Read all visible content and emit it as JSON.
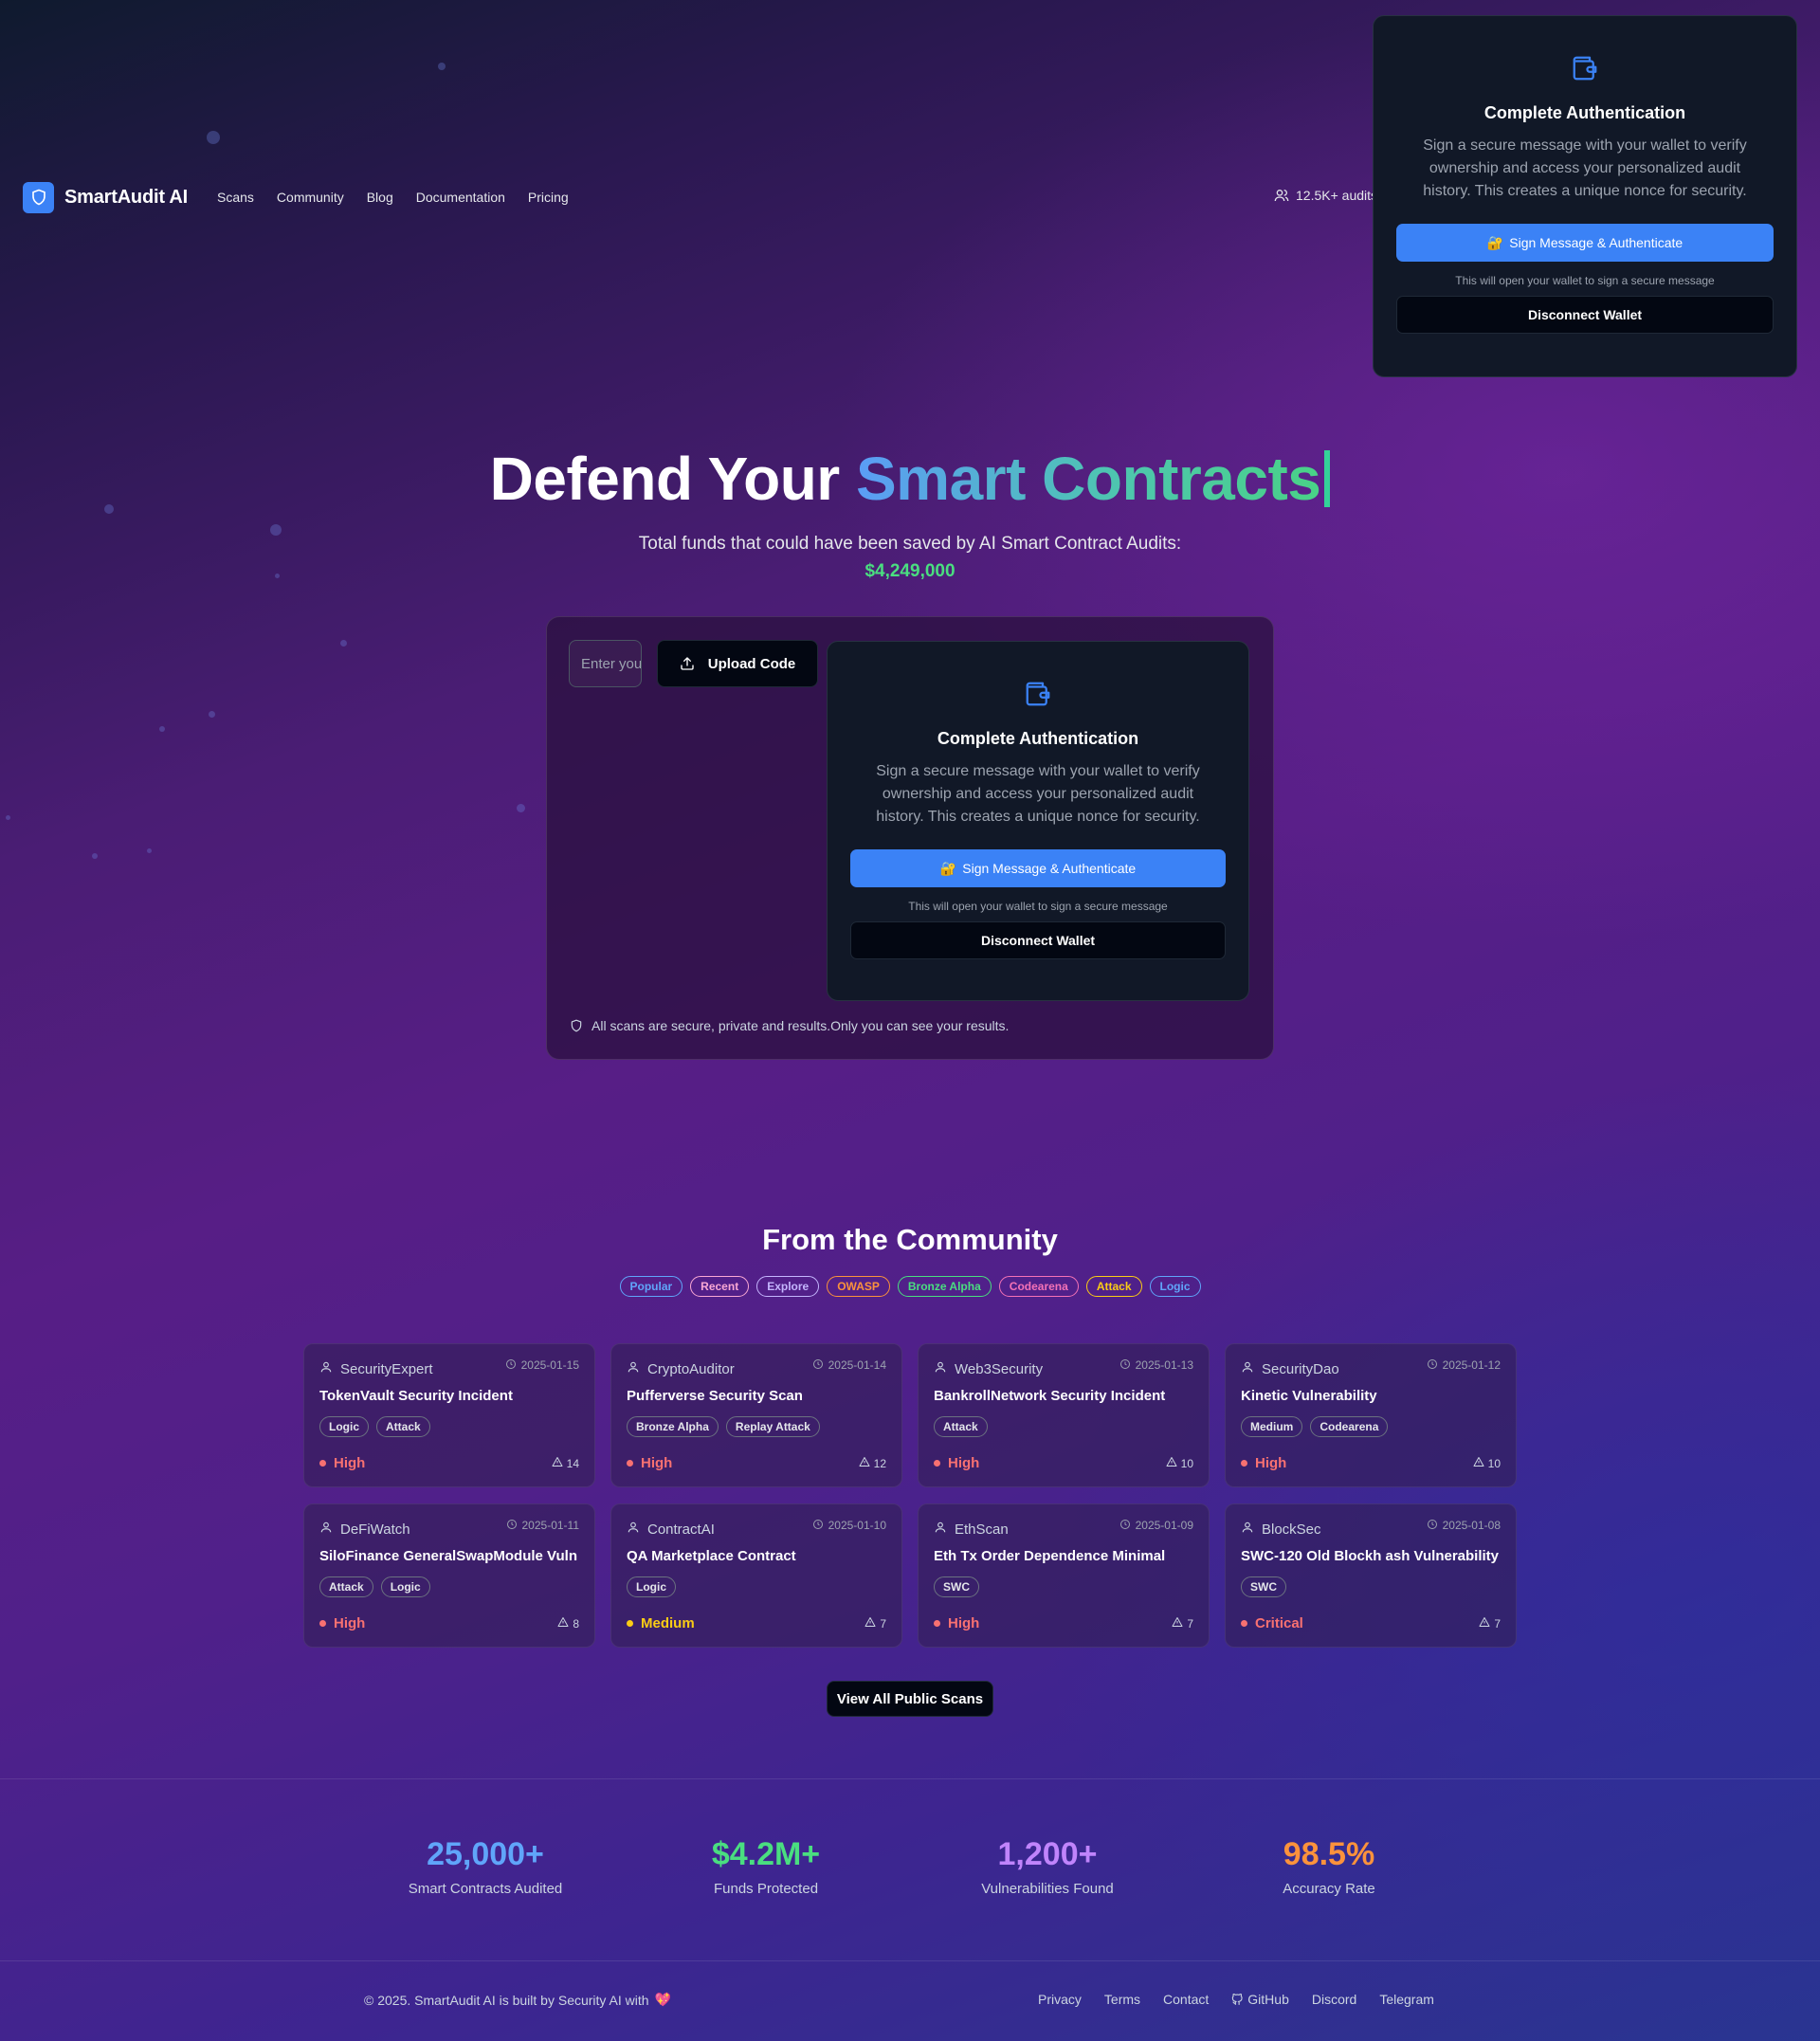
{
  "brand": {
    "name": "SmartAudit AI"
  },
  "nav": {
    "links": [
      "Scans",
      "Community",
      "Blog",
      "Documentation",
      "Pricing"
    ],
    "audits_count": "12.5K+ audits"
  },
  "auth_modal": {
    "title": "Complete Authentication",
    "description": "Sign a secure message with your wallet to verify ownership and access your personalized audit history. This creates a unique nonce for security.",
    "sign_button": "Sign Message & Authenticate",
    "sign_emoji": "🔐",
    "hint": "This will open your wallet to sign a secure message",
    "disconnect_button": "Disconnect Wallet"
  },
  "hero": {
    "title_plain": "Defend Your ",
    "title_gradient": "Smart Contracts",
    "subtitle": "Total funds that could have been saved by AI Smart Contract Audits:",
    "amount": "$4,249,000"
  },
  "scan": {
    "input_placeholder": "Enter your contract address",
    "upload_label": "Upload Code",
    "secure_note": "All scans are secure, private and results.Only you can see your results."
  },
  "community": {
    "title": "From the Community",
    "filters": [
      {
        "label": "Popular",
        "color": "#60a5fa"
      },
      {
        "label": "Recent",
        "color": "#f9a8d4"
      },
      {
        "label": "Explore",
        "color": "#c4b5fd"
      },
      {
        "label": "OWASP",
        "color": "#fb923c"
      },
      {
        "label": "Bronze Alpha",
        "color": "#4ade80"
      },
      {
        "label": "Codearena",
        "color": "#f472b6"
      },
      {
        "label": "Attack",
        "color": "#facc15"
      },
      {
        "label": "Logic",
        "color": "#60a5fa"
      }
    ],
    "cards": [
      {
        "author": "SecurityExpert",
        "date": "2025-01-15",
        "title": "TokenVault Security Incident",
        "tags": [
          "Logic",
          "Attack"
        ],
        "severity": "High",
        "severity_color": "#f87171",
        "count": "14"
      },
      {
        "author": "CryptoAuditor",
        "date": "2025-01-14",
        "title": "Pufferverse Security Scan",
        "tags": [
          "Bronze Alpha",
          "Replay Attack"
        ],
        "severity": "High",
        "severity_color": "#f87171",
        "count": "12"
      },
      {
        "author": "Web3Security",
        "date": "2025-01-13",
        "title": "BankrollNetwork Security Incident",
        "tags": [
          "Attack"
        ],
        "severity": "High",
        "severity_color": "#f87171",
        "count": "10"
      },
      {
        "author": "SecurityDao",
        "date": "2025-01-12",
        "title": "Kinetic Vulnerability",
        "tags": [
          "Medium",
          "Codearena"
        ],
        "severity": "High",
        "severity_color": "#f87171",
        "count": "10"
      },
      {
        "author": "DeFiWatch",
        "date": "2025-01-11",
        "title": "SiloFinance GeneralSwapModule Vuln",
        "tags": [
          "Attack",
          "Logic"
        ],
        "severity": "High",
        "severity_color": "#f87171",
        "count": "8"
      },
      {
        "author": "ContractAI",
        "date": "2025-01-10",
        "title": "QA Marketplace Contract",
        "tags": [
          "Logic"
        ],
        "severity": "Medium",
        "severity_color": "#facc15",
        "count": "7"
      },
      {
        "author": "EthScan",
        "date": "2025-01-09",
        "title": "Eth Tx Order Dependence Minimal",
        "tags": [
          "SWC"
        ],
        "severity": "High",
        "severity_color": "#f87171",
        "count": "7"
      },
      {
        "author": "BlockSec",
        "date": "2025-01-08",
        "title": "SWC-120 Old Blockh ash Vulnerability",
        "tags": [
          "SWC"
        ],
        "severity": "Critical",
        "severity_color": "#f87171",
        "count": "7"
      }
    ],
    "view_all": "View All Public Scans"
  },
  "stats": [
    {
      "value": "25,000+",
      "label": "Smart Contracts Audited",
      "color": "#60a5fa"
    },
    {
      "value": "$4.2M+",
      "label": "Funds Protected",
      "color": "#4ade80"
    },
    {
      "value": "1,200+",
      "label": "Vulnerabilities Found",
      "color": "#c084fc"
    },
    {
      "value": "98.5%",
      "label": "Accuracy Rate",
      "color": "#fb923c"
    }
  ],
  "footer": {
    "copyright": "© 2025. SmartAudit AI is built by Security AI with",
    "heart": "💖",
    "links": [
      "Privacy",
      "Terms",
      "Contact",
      "GitHub",
      "Discord",
      "Telegram"
    ]
  },
  "theme": {
    "accent": "#3b82f6",
    "success": "#4ade80"
  }
}
